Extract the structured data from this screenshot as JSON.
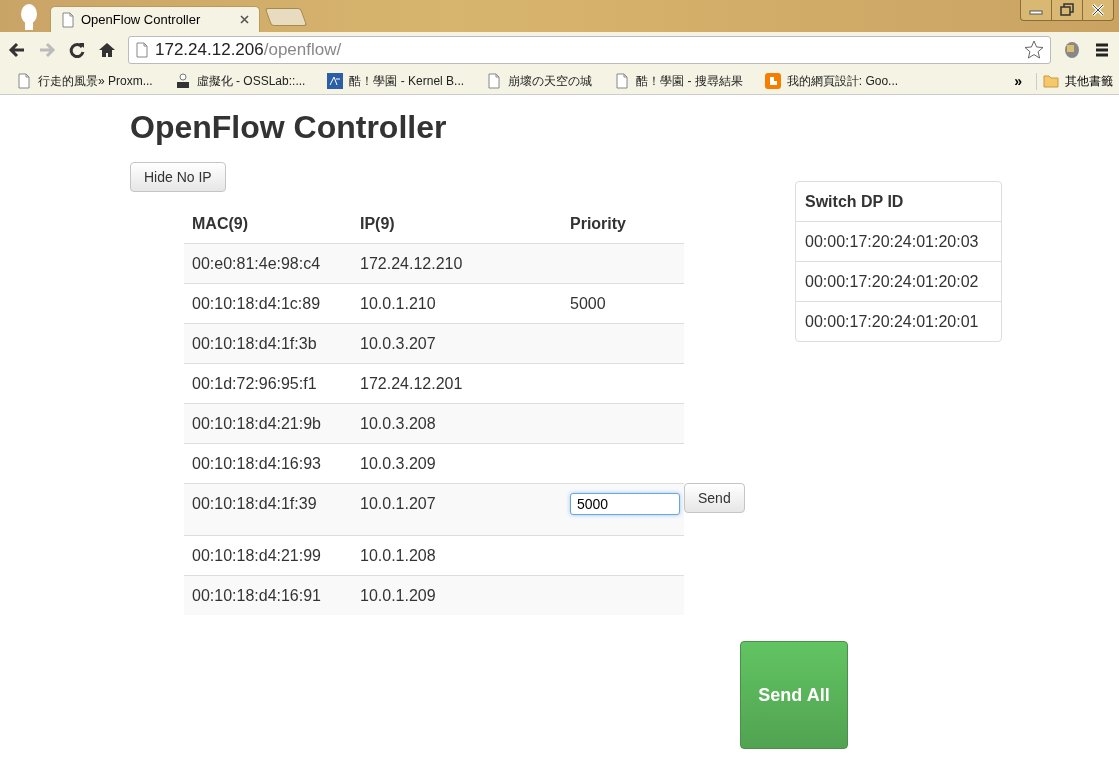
{
  "browser": {
    "tab_title": "OpenFlow Controller",
    "url_host": "172.24.12.206",
    "url_path": "/openflow/",
    "bookmarks": [
      {
        "kind": "page",
        "label": "行走的風景» Proxm..."
      },
      {
        "kind": "oss",
        "label": "虛擬化 - OSSLab::..."
      },
      {
        "kind": "sa",
        "label": "酷！學園 - Kernel B..."
      },
      {
        "kind": "page",
        "label": "崩壞の天空の城"
      },
      {
        "kind": "page",
        "label": "酷！學園 - 搜尋結果"
      },
      {
        "kind": "blogger",
        "label": "我的網頁設計: Goo..."
      }
    ],
    "overflow": "»",
    "other_bookmarks": "其他書籤"
  },
  "page": {
    "title": "OpenFlow Controller",
    "hide_button": "Hide No IP",
    "table": {
      "columns": [
        "MAC(9)",
        "IP(9)",
        "Priority"
      ],
      "rows": [
        {
          "kind": "text",
          "mac": "00:e0:81:4e:98:c4",
          "ip": "172.24.12.210"
        },
        {
          "kind": "text",
          "mac": "00:10:18:d4:1c:89",
          "ip": "10.0.1.210",
          "priority": "5000"
        },
        {
          "kind": "text",
          "mac": "00:10:18:d4:1f:3b",
          "ip": "10.0.3.207"
        },
        {
          "kind": "text",
          "mac": "00:1d:72:96:95:f1",
          "ip": "172.24.12.201"
        },
        {
          "kind": "text",
          "mac": "00:10:18:d4:21:9b",
          "ip": "10.0.3.208"
        },
        {
          "kind": "text",
          "mac": "00:10:18:d4:16:93",
          "ip": "10.0.3.209"
        },
        {
          "kind": "editing",
          "mac": "00:10:18:d4:1f:39",
          "ip": "10.0.1.207",
          "priority": "5000",
          "action": "Send"
        },
        {
          "kind": "text",
          "mac": "00:10:18:d4:21:99",
          "ip": "10.0.1.208"
        },
        {
          "kind": "text",
          "mac": "00:10:18:d4:16:91",
          "ip": "10.0.1.209"
        }
      ]
    },
    "switch_table": {
      "column": "Switch DP ID",
      "rows": [
        "00:00:17:20:24:01:20:03",
        "00:00:17:20:24:01:20:02",
        "00:00:17:20:24:01:20:01"
      ]
    },
    "send_all_button": "Send All"
  }
}
